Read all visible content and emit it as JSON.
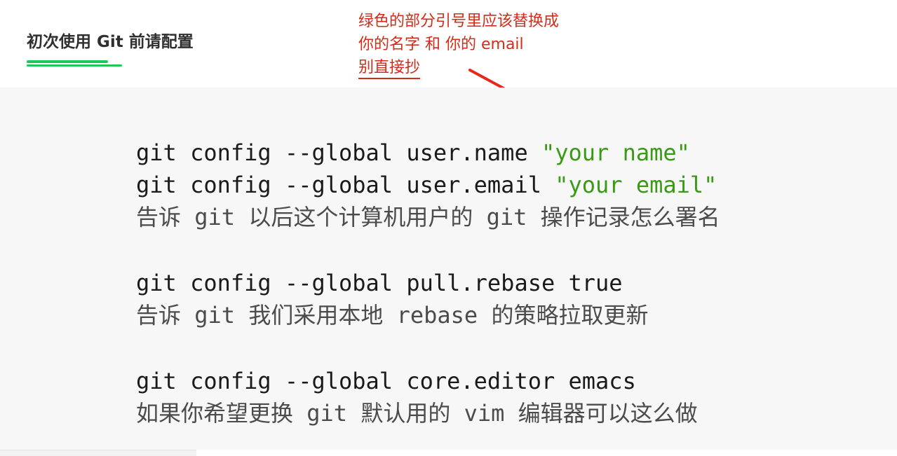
{
  "header": {
    "title": "初次使用 Git 前请配置",
    "underline_color": "#1fc75b"
  },
  "annotation": {
    "lines": [
      "绿色的部分引号里应该替换成",
      "你的名字  和  你的 email",
      "别直接抄"
    ],
    "color": "#d52b19"
  },
  "code": {
    "line1_cmd": "git config --global user.name ",
    "line1_str": "\"your name\"",
    "line2_cmd": "git config --global user.email ",
    "line2_str": "\"your email\"",
    "line3_comment": "告诉 git 以后这个计算机用户的 git 操作记录怎么署名",
    "line4_cmd": "git config --global pull.rebase true",
    "line5_comment": "告诉 git 我们采用本地 rebase 的策略拉取更新",
    "line6_cmd": "git config --global core.editor emacs",
    "line7_comment": "如果你希望更换 git 默认用的 vim 编辑器可以这么做",
    "string_color": "#3a9a16"
  }
}
